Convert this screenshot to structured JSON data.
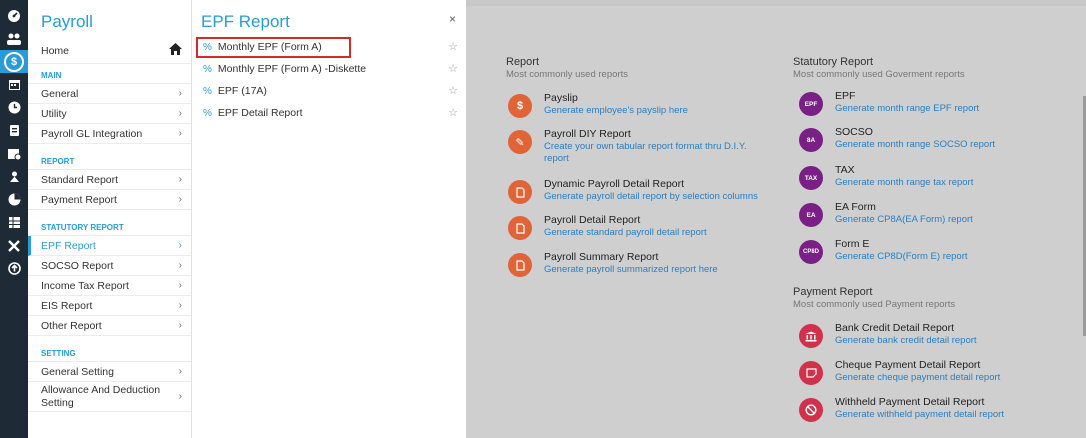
{
  "rail": {
    "icons": [
      "dashboard-icon",
      "users-icon",
      "payroll-icon",
      "calendar-icon",
      "clock-icon",
      "claims-icon",
      "leave-icon",
      "appraisal-icon",
      "reports-icon",
      "table-icon",
      "tools-icon",
      "upload-icon"
    ]
  },
  "menu1": {
    "title": "Payroll",
    "home_label": "Home",
    "sections": {
      "main": "MAIN",
      "report": "REPORT",
      "statutory": "STATUTORY REPORT",
      "setting": "SETTING"
    },
    "main_items": [
      "General",
      "Utility",
      "Payroll GL Integration"
    ],
    "report_items": [
      "Standard Report",
      "Payment Report"
    ],
    "statutory_items": [
      "EPF Report",
      "SOCSO Report",
      "Income Tax Report",
      "EIS Report",
      "Other Report"
    ],
    "setting_items": [
      "General Setting",
      "Allowance And Deduction Setting"
    ]
  },
  "menu2": {
    "title": "EPF Report",
    "close_label": "×",
    "items": [
      "Monthly EPF (Form A)",
      "Monthly EPF (Form A) -Diskette",
      "EPF (17A)",
      "EPF Detail Report"
    ]
  },
  "main": {
    "report": {
      "title": "Report",
      "subtitle": "Most commonly used reports",
      "items": [
        {
          "name": "Payslip",
          "desc": "Generate employee's payslip here"
        },
        {
          "name": "Payroll DIY Report",
          "desc": "Create your own tabular report format thru D.I.Y. report"
        },
        {
          "name": "Dynamic Payroll Detail Report",
          "desc": "Generate payroll detail report by selection columns"
        },
        {
          "name": "Payroll Detail Report",
          "desc": "Generate standard payroll detail report"
        },
        {
          "name": "Payroll Summary Report",
          "desc": "Generate payroll summarized report here"
        }
      ]
    },
    "statutory": {
      "title": "Statutory Report",
      "subtitle": "Most commonly used Goverment reports",
      "items": [
        {
          "badge": "EPF",
          "name": "EPF",
          "desc": "Generate month range EPF report"
        },
        {
          "badge": "8A",
          "name": "SOCSO",
          "desc": "Generate month range SOCSO report"
        },
        {
          "badge": "TAX",
          "name": "TAX",
          "desc": "Generate month range tax report"
        },
        {
          "badge": "EA",
          "name": "EA Form",
          "desc": "Generate CP8A(EA Form) report"
        },
        {
          "badge": "CP8D",
          "name": "Form E",
          "desc": "Generate CP8D(Form E) report"
        }
      ]
    },
    "payment": {
      "title": "Payment Report",
      "subtitle": "Most commonly used Payment reports",
      "items": [
        {
          "name": "Bank Credit Detail Report",
          "desc": "Generate bank credit detail report"
        },
        {
          "name": "Cheque Payment Detail Report",
          "desc": "Generate cheque payment detail report"
        },
        {
          "name": "Withheld Payment Detail Report",
          "desc": "Generate withheld payment detail report"
        }
      ]
    }
  }
}
